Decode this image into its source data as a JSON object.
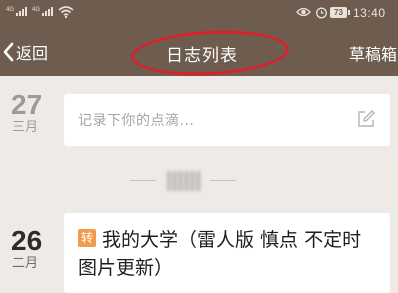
{
  "status_bar": {
    "signal1_tag": "4G",
    "signal2_tag": "4G",
    "battery": "73",
    "time": "13:40",
    "icons": [
      "signal-icon",
      "signal-icon",
      "wifi-icon",
      "eye-icon",
      "alarm-icon",
      "battery-icon"
    ]
  },
  "nav": {
    "back_label": "返回",
    "title": "日志列表",
    "drafts_label": "草稿箱",
    "annotation_color": "#d8212a"
  },
  "entries": [
    {
      "day": "27",
      "month": "三月",
      "compose_placeholder": "记录下你的点滴..."
    },
    {
      "day": "26",
      "month": "二月",
      "badge": "转",
      "title": "我的大学（雷人版  慎点 不定时图片更新）"
    }
  ],
  "colors": {
    "header_bg": "#6e5d4f",
    "page_bg": "#eeebe6",
    "badge": "#f29b4a"
  }
}
